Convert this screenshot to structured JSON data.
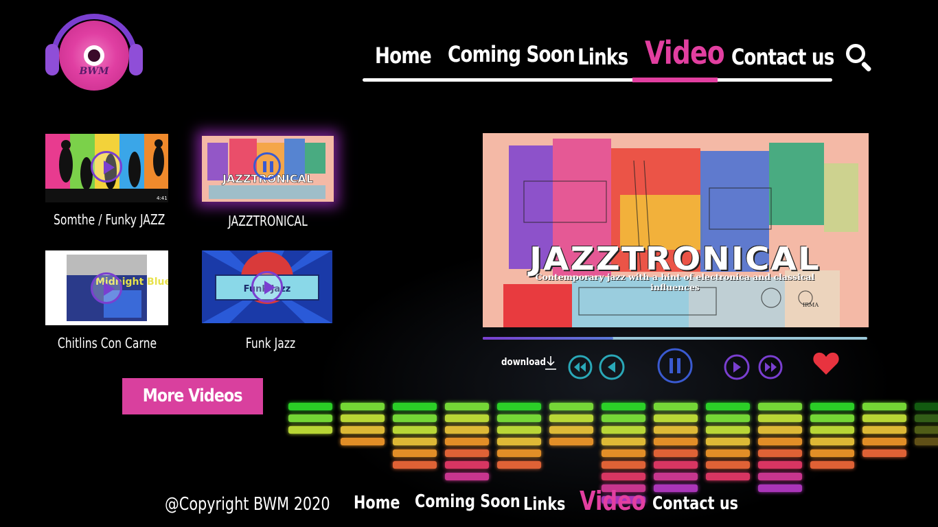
{
  "brand": {
    "logo_text": "BWM"
  },
  "nav": {
    "items": [
      {
        "label": "Home",
        "active": false
      },
      {
        "label": "Coming Soon",
        "active": false
      },
      {
        "label": "Links",
        "active": false
      },
      {
        "label": "Video",
        "active": true
      },
      {
        "label": "Contact us",
        "active": false
      }
    ],
    "search_icon": "search-icon",
    "active_color": "#e23fa0"
  },
  "videos": [
    {
      "title": "Somthe / Funky JAZZ",
      "duration": "4:41",
      "state": "play"
    },
    {
      "title": "JAZZTRONICAL",
      "state": "pause",
      "selected": true
    },
    {
      "title": "Chitlins Con Carne",
      "state": "play",
      "cover_text": "Midnight Blue"
    },
    {
      "title": "Funk Jazz",
      "state": "play",
      "cover_text": "Funk Jazz"
    }
  ],
  "more_button": "More Videos",
  "player": {
    "title": "JAZZTRONICAL",
    "subtitle": "Contemporary jazz with a hint of electronica and classical influences",
    "artist_mark": "IRMA",
    "progress": 0.34,
    "download_label": "download",
    "controls": [
      "rewind-icon",
      "previous-icon",
      "pause-icon",
      "next-icon",
      "fast-forward-icon",
      "heart-icon"
    ]
  },
  "footer": {
    "copyright": "@Copyright BWM 2020",
    "nav": [
      "Home",
      "Coming Soon",
      "Links",
      "Video",
      "Contact us"
    ]
  },
  "colors": {
    "accent": "#d9409e",
    "purple": "#7a3fd0",
    "teal": "#2aa8b8"
  }
}
